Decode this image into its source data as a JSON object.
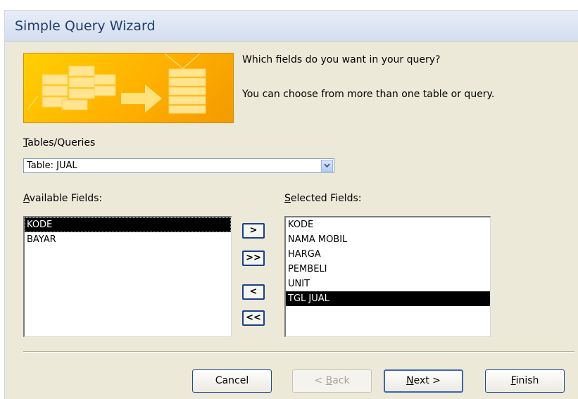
{
  "window": {
    "title": "Simple Query Wizard"
  },
  "intro": {
    "question": "Which fields do you want in your query?",
    "hint": "You can choose from more than one table or query."
  },
  "tables": {
    "label_hotkey": "T",
    "label_rest": "ables/Queries",
    "selected": "Table: JUAL"
  },
  "available": {
    "label_hotkey": "A",
    "label_rest": "vailable Fields:",
    "items": [
      "KODE",
      "BAYAR"
    ],
    "selected_index": 0
  },
  "selected_fields": {
    "label_hotkey": "S",
    "label_rest": "elected Fields:",
    "items": [
      "KODE",
      "NAMA MOBIL",
      "HARGA",
      "PEMBELI",
      "UNIT",
      "TGL JUAL"
    ],
    "selected_index": 5
  },
  "move_buttons": {
    "add_one": ">",
    "add_all": ">>",
    "remove_one": "<",
    "remove_all": "<<"
  },
  "footer": {
    "cancel": "Cancel",
    "back_prefix": "< ",
    "back_hotkey": "B",
    "back_rest": "ack",
    "next_hotkey": "N",
    "next_rest": "ext >",
    "finish_hotkey": "F",
    "finish_rest": "inish"
  },
  "colors": {
    "banner": "#ffc000",
    "selection": "#000000",
    "dialog_bg": "#ece9d8"
  }
}
